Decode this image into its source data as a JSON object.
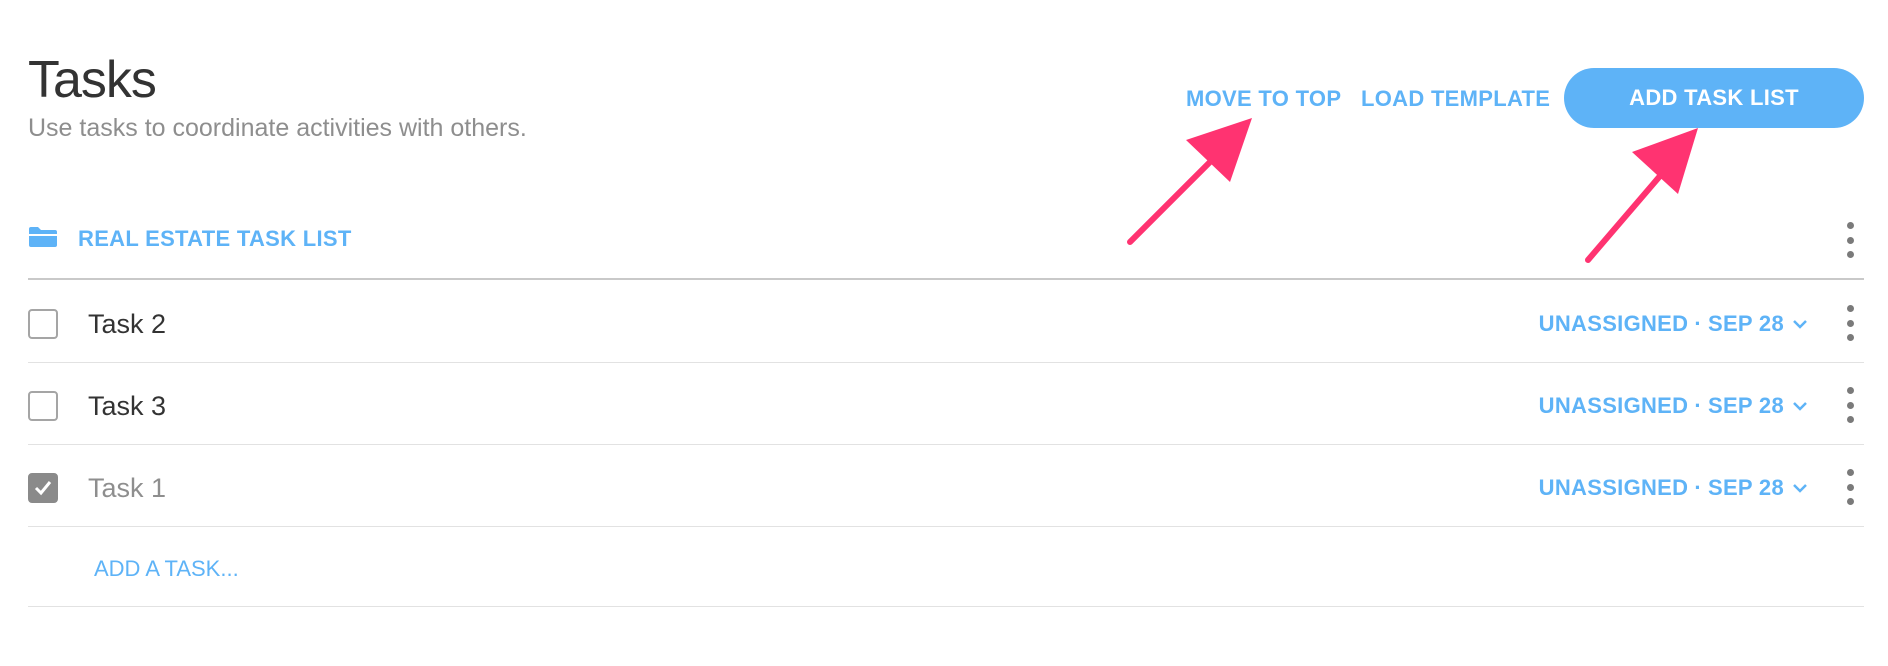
{
  "header": {
    "title": "Tasks",
    "subtitle": "Use tasks to coordinate activities with others.",
    "move_to_top_label": "MOVE TO TOP",
    "load_template_label": "LOAD TEMPLATE",
    "add_task_list_label": "ADD TASK LIST"
  },
  "task_list": {
    "title": "REAL ESTATE TASK LIST",
    "icon": "folder-icon",
    "tasks": [
      {
        "label": "Task 2",
        "checked": false,
        "assignee": "UNASSIGNED",
        "separator": "·",
        "due": "SEP 28"
      },
      {
        "label": "Task 3",
        "checked": false,
        "assignee": "UNASSIGNED",
        "separator": "·",
        "due": "SEP 28"
      },
      {
        "label": "Task 1",
        "checked": true,
        "assignee": "UNASSIGNED",
        "separator": "·",
        "due": "SEP 28"
      }
    ],
    "add_task_label": "ADD A TASK..."
  },
  "colors": {
    "accent": "#5eb3f7",
    "annotation_arrow": "#ff3371",
    "title_text": "#333333",
    "muted_text": "#8e8e8e"
  }
}
